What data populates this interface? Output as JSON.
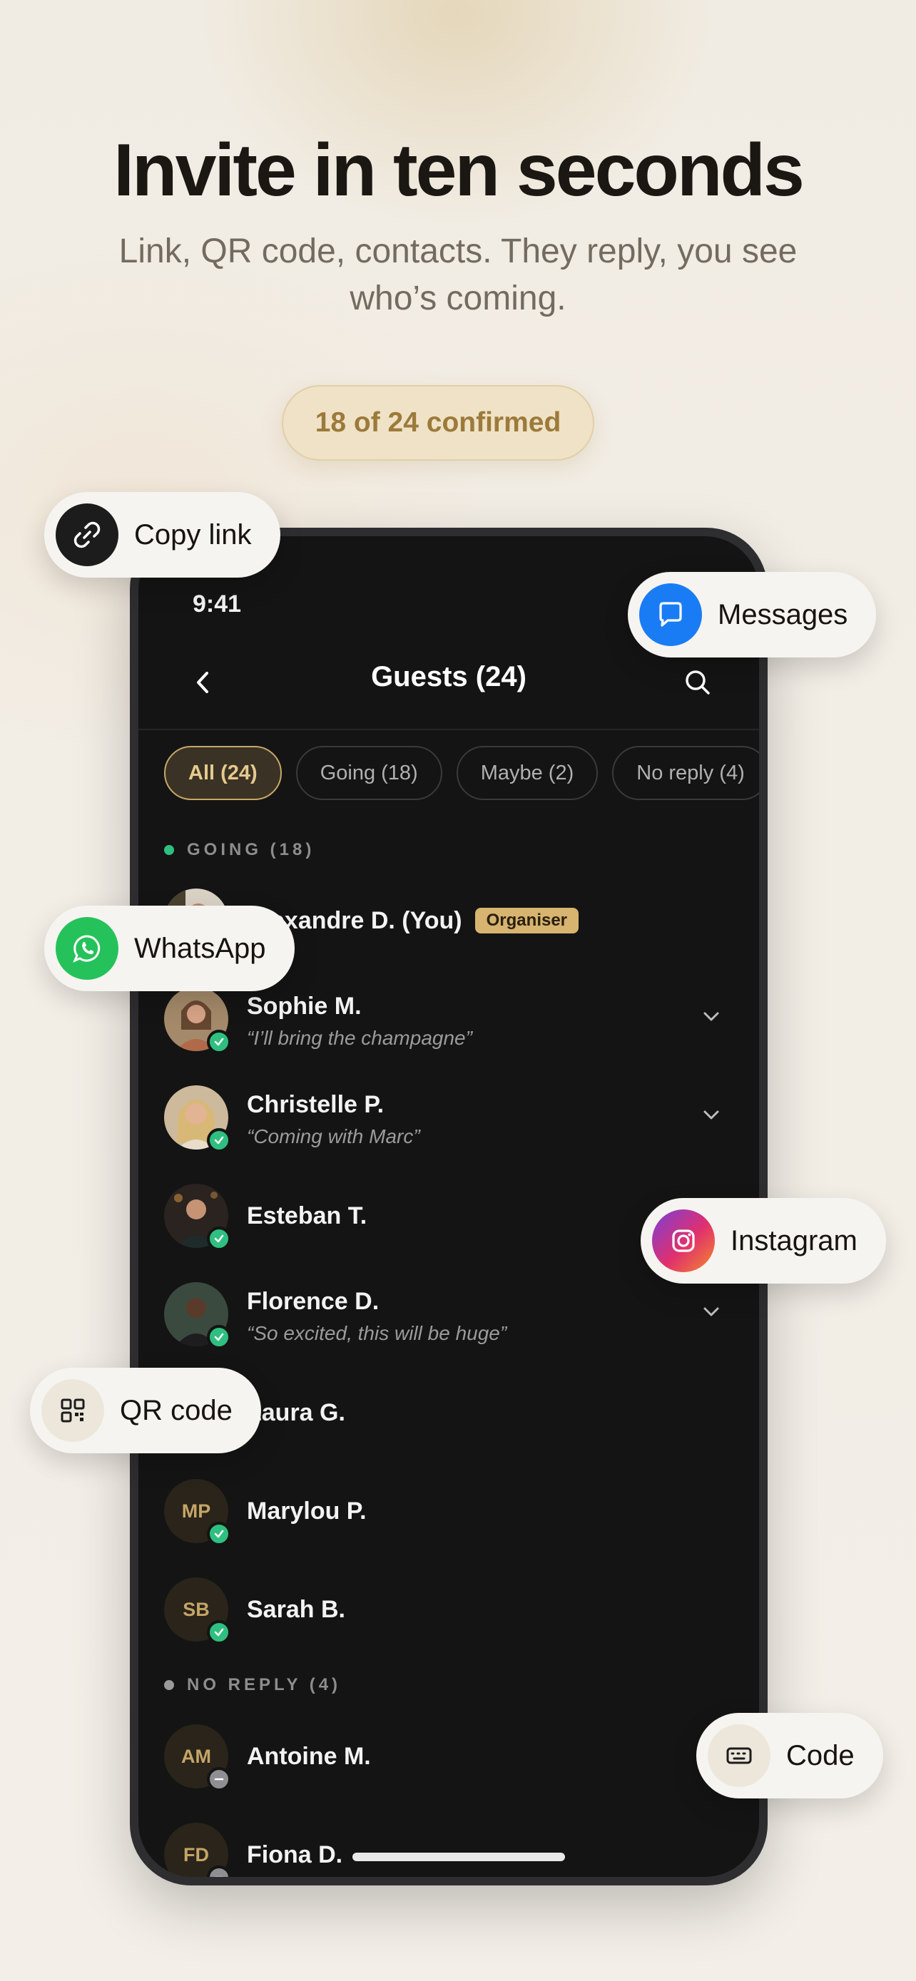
{
  "hero": {
    "headline": "Invite in ten seconds",
    "subhead": "Link, QR code, contacts. They reply, you see who’s coming.",
    "confirmed_badge": "18 of 24 confirmed"
  },
  "share_options": {
    "copy_link": "Copy link",
    "messages": "Messages",
    "whatsapp": "WhatsApp",
    "instagram": "Instagram",
    "qr_code": "QR code",
    "code": "Code"
  },
  "phone": {
    "status_time": "9:41",
    "nav_title": "Guests (24)",
    "filters": [
      "All (24)",
      "Going (18)",
      "Maybe (2)",
      "No reply (4)"
    ],
    "sections": {
      "going": "GOING (18)",
      "no_reply": "NO REPLY (4)"
    },
    "guests": [
      {
        "name": "Alexandre D. (You)",
        "badge": "Organiser",
        "note": ""
      },
      {
        "name": "Sophie M.",
        "note": "“I’ll bring the champagne”"
      },
      {
        "name": "Christelle P.",
        "note": "“Coming with Marc”"
      },
      {
        "name": "Esteban T.",
        "note": ""
      },
      {
        "name": "Florence D.",
        "note": "“So excited, this will be huge”"
      },
      {
        "name": "Laura G.",
        "note": ""
      },
      {
        "name": "Marylou P.",
        "initials": "MP",
        "note": ""
      },
      {
        "name": "Sarah B.",
        "initials": "SB",
        "note": ""
      }
    ],
    "no_reply_guests": [
      {
        "name": "Antoine M.",
        "initials": "AM"
      },
      {
        "name": "Fiona D.",
        "initials": "FD"
      }
    ]
  },
  "colors": {
    "accent_gold": "#c9a868",
    "going_green": "#2fbf80",
    "messages_blue": "#1a7cf5",
    "whatsapp_green": "#25c25b"
  },
  "icons": [
    "link-icon",
    "message-bubble-icon",
    "whatsapp-icon",
    "instagram-icon",
    "qr-code-icon",
    "keyboard-icon",
    "chevron-left-icon",
    "search-icon",
    "chevron-down-icon",
    "check-icon",
    "minus-icon"
  ]
}
